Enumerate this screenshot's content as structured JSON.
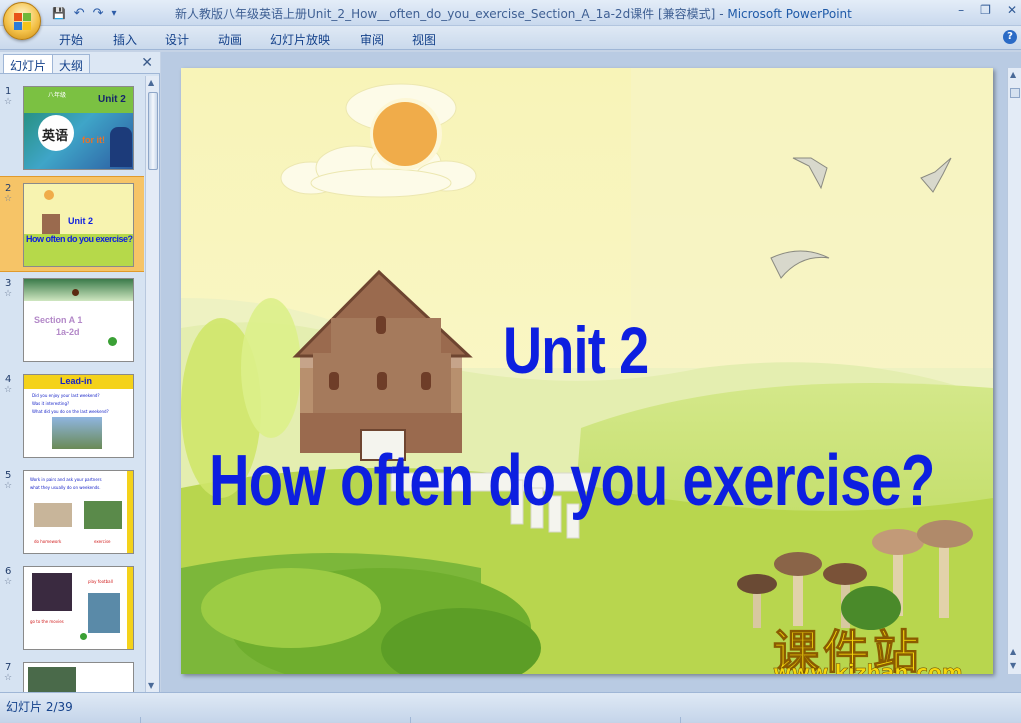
{
  "window": {
    "title": "新人教版八年级英语上册Unit_2_How__often_do_you_exercise_Section_A_1a-2d课件 [兼容模式]",
    "separator": " - ",
    "app": "Microsoft PowerPoint",
    "controls": [
      "–",
      "❐",
      "✕"
    ]
  },
  "qat": {
    "save": "💾",
    "undo": "↶",
    "redo": "↷",
    "more": "▾"
  },
  "menu": {
    "tabs": [
      "开始",
      "插入",
      "设计",
      "动画",
      "幻灯片放映",
      "审阅",
      "视图"
    ],
    "help": "?"
  },
  "panel": {
    "tab_slides": "幻灯片",
    "tab_outline": "大纲",
    "close": "✕",
    "thumbnails": [
      {
        "num": "1",
        "star": "☆",
        "badge": "八年级",
        "unit": "Unit 2",
        "subject": "英语",
        "extra": "for it!"
      },
      {
        "num": "2",
        "star": "☆",
        "unit": "Unit 2",
        "title": "How often do you exercise?"
      },
      {
        "num": "3",
        "star": "☆",
        "line1": "Section A 1",
        "line2": "1a-2d"
      },
      {
        "num": "4",
        "star": "☆",
        "heading": "Lead-in",
        "q1": "Did you enjoy your last weekend?",
        "q2": "Was it interesting?",
        "q3": "What did you do on the last weekend?"
      },
      {
        "num": "5",
        "star": "☆",
        "line1": "Work in pairs and ask your partners",
        "line2": "what they usually do on weekends.",
        "cap1": "do homework",
        "cap2": "exercise"
      },
      {
        "num": "6",
        "star": "☆",
        "cap1": "play football",
        "cap2": "go to the movies"
      },
      {
        "num": "7",
        "star": "☆"
      }
    ]
  },
  "slide": {
    "title_line1": "Unit 2",
    "title_line2": "How often do you exercise?",
    "watermark_cn": "课件站",
    "watermark_url": "www.kjzhan.com"
  },
  "status": {
    "slide_info": "幻灯片 2/39"
  },
  "colors": {
    "title_blue": "#0d1fe0",
    "sky": "#f7f3b0",
    "grass": "#b6d94a",
    "house": "#9a6a4e",
    "watermark": "#f5d80c",
    "selection": "#f6c467"
  }
}
